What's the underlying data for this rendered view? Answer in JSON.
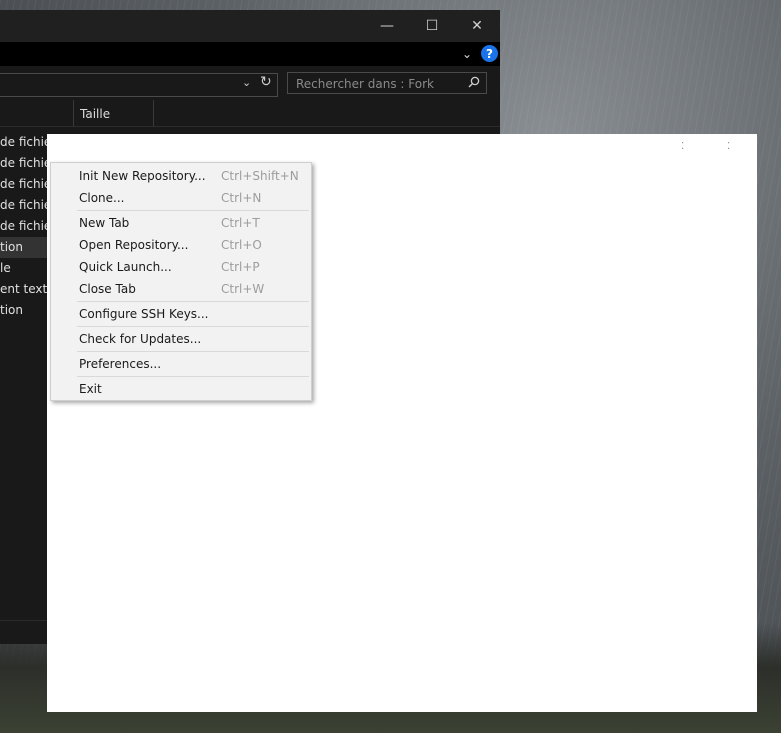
{
  "window_controls": {
    "minimize": "—",
    "maximize": "☐",
    "close": "✕"
  },
  "ribbon": {
    "chevron": "⌄",
    "help": "?"
  },
  "addressbar": {
    "dropdown": "⌄",
    "refresh": "↻"
  },
  "search": {
    "placeholder": "Rechercher dans : Fork",
    "icon": "search-icon"
  },
  "columns": {
    "size": "Taille"
  },
  "rows": [
    "de fichie",
    "de fichie",
    "de fichie",
    "de fichie",
    "de fichie",
    "tion",
    "le",
    "ent texte",
    "tion"
  ],
  "selected_row": 5,
  "fork": {
    "dot1": "⁚",
    "dot2": "⁚"
  },
  "menu": {
    "items": [
      {
        "label": "Init New Repository...",
        "shortcut": "Ctrl+Shift+N"
      },
      {
        "label": "Clone...",
        "shortcut": "Ctrl+N"
      },
      {
        "label": "New Tab",
        "shortcut": "Ctrl+T"
      },
      {
        "label": "Open Repository...",
        "shortcut": "Ctrl+O"
      },
      {
        "label": "Quick Launch...",
        "shortcut": "Ctrl+P"
      },
      {
        "label": "Close Tab",
        "shortcut": "Ctrl+W"
      },
      {
        "label": "Configure SSH Keys...",
        "shortcut": ""
      },
      {
        "label": "Check for Updates...",
        "shortcut": ""
      },
      {
        "label": "Preferences...",
        "shortcut": ""
      },
      {
        "label": "Exit",
        "shortcut": ""
      }
    ]
  },
  "colors": {
    "accent": "#1a73e8",
    "explorer_bg": "#191919",
    "menu_bg": "#f2f2f2"
  }
}
